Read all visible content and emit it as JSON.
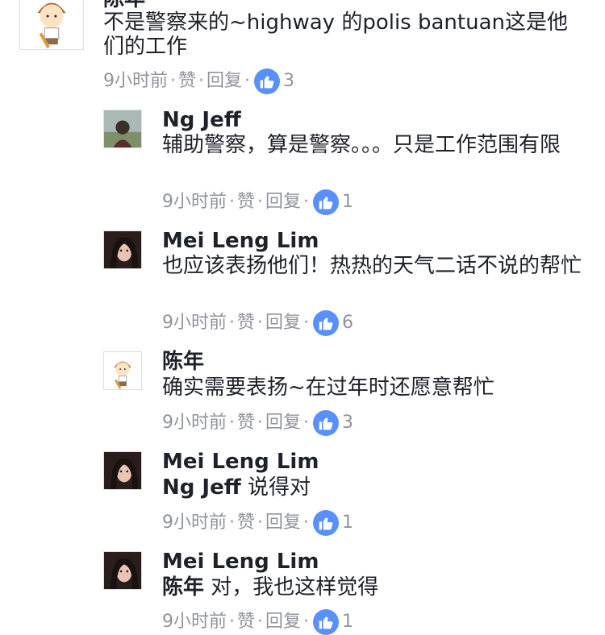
{
  "comments": [
    {
      "name": "陈年",
      "text": "不是警察来的~highway 的polis bantuan这是他们的工作",
      "time": "9小时前",
      "like_label": "赞",
      "reply_label": "回复",
      "likes": "3",
      "avatar": "cartoon-boy-avatar"
    },
    {
      "name": "Ng Jeff",
      "text": "辅助警察，算是警察。。。只是工作范围有限",
      "time": "9小时前",
      "like_label": "赞",
      "reply_label": "回复",
      "likes": "1",
      "avatar": "person-photo-avatar"
    },
    {
      "name": "Mei Leng Lim",
      "text": "也应该表扬他们！热热的天气二话不说的帮忙",
      "time": "9小时前",
      "like_label": "赞",
      "reply_label": "回复",
      "likes": "6",
      "avatar": "woman-photo-avatar"
    },
    {
      "name": "陈年",
      "text": "确实需要表扬~在过年时还愿意帮忙",
      "time": "9小时前",
      "like_label": "赞",
      "reply_label": "回复",
      "likes": "3",
      "avatar": "cartoon-boy-avatar"
    },
    {
      "name": "Mei Leng Lim",
      "mention": "Ng Jeff",
      "text": " 说得对",
      "time": "9小时前",
      "like_label": "赞",
      "reply_label": "回复",
      "likes": "1",
      "avatar": "woman-photo-avatar"
    },
    {
      "name": "Mei Leng Lim",
      "mention": "陈年",
      "text": " 对，我也这样觉得",
      "time": "9小时前",
      "like_label": "赞",
      "reply_label": "回复",
      "likes": "1",
      "avatar": "woman-photo-avatar"
    }
  ],
  "colors": {
    "like_badge": "#5890ff",
    "meta_text": "#90949c",
    "name_text": "#1d2129"
  },
  "icons": {
    "like": "thumbs-up-icon"
  }
}
